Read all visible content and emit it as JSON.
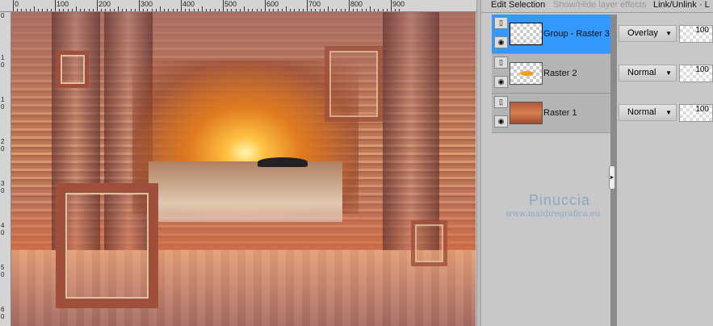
{
  "ruler": {
    "h_labels": [
      "0",
      "100",
      "200",
      "300",
      "400",
      "500",
      "600",
      "700",
      "800",
      "900"
    ],
    "v_labels": [
      "0",
      "1\n0",
      "1\n0",
      "2\n0",
      "3\n0",
      "4\n0",
      "5\n0",
      "6\n0"
    ]
  },
  "toolbar": {
    "edit_selection": "Edit Selection",
    "show_hide": "Show/Hide layer effects",
    "link_unlink": "Link/Unlink · L"
  },
  "layers": [
    {
      "name": "Group - Raster 3",
      "blend": "Overlay",
      "opacity": "100",
      "selected": true
    },
    {
      "name": "Raster 2",
      "blend": "Normal",
      "opacity": "100",
      "selected": false
    },
    {
      "name": "Raster 1",
      "blend": "Normal",
      "opacity": "100",
      "selected": false
    }
  ],
  "watermark": {
    "name": "Pinuccia",
    "url": "www.maidiregrafica.eu"
  },
  "colors": {
    "selection": "#3399ff",
    "panel": "#c8c8c8"
  }
}
